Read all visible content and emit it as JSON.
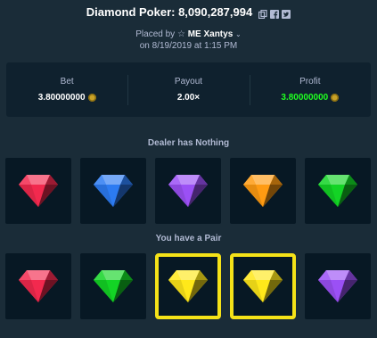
{
  "header": {
    "title": "Diamond Poker: 8,090,287,994",
    "icons": [
      "copy-icon",
      "facebook-icon",
      "twitter-icon"
    ]
  },
  "placed": {
    "prefix": "Placed by",
    "user": "ME Xantys",
    "date": "on 8/19/2019 at 1:15 PM"
  },
  "stats": {
    "bet_label": "Bet",
    "bet_value": "3.80000000",
    "payout_label": "Payout",
    "payout_value": "2.00×",
    "profit_label": "Profit",
    "profit_value": "3.80000000"
  },
  "dealer": {
    "title": "Dealer has Nothing",
    "gems": [
      "red",
      "blue",
      "purple",
      "orange",
      "green"
    ]
  },
  "player": {
    "title": "You have a Pair",
    "gems": [
      "red",
      "green",
      "yellow",
      "yellow",
      "purple"
    ],
    "highlighted": [
      false,
      false,
      true,
      true,
      false
    ]
  },
  "colors": {
    "red": "#f2294e",
    "blue": "#2c7bf2",
    "purple": "#9b50f5",
    "orange": "#ff9b12",
    "green": "#13d425",
    "yellow": "#ffe81a",
    "highlight": "#f5e218",
    "profit": "#1fff20"
  }
}
